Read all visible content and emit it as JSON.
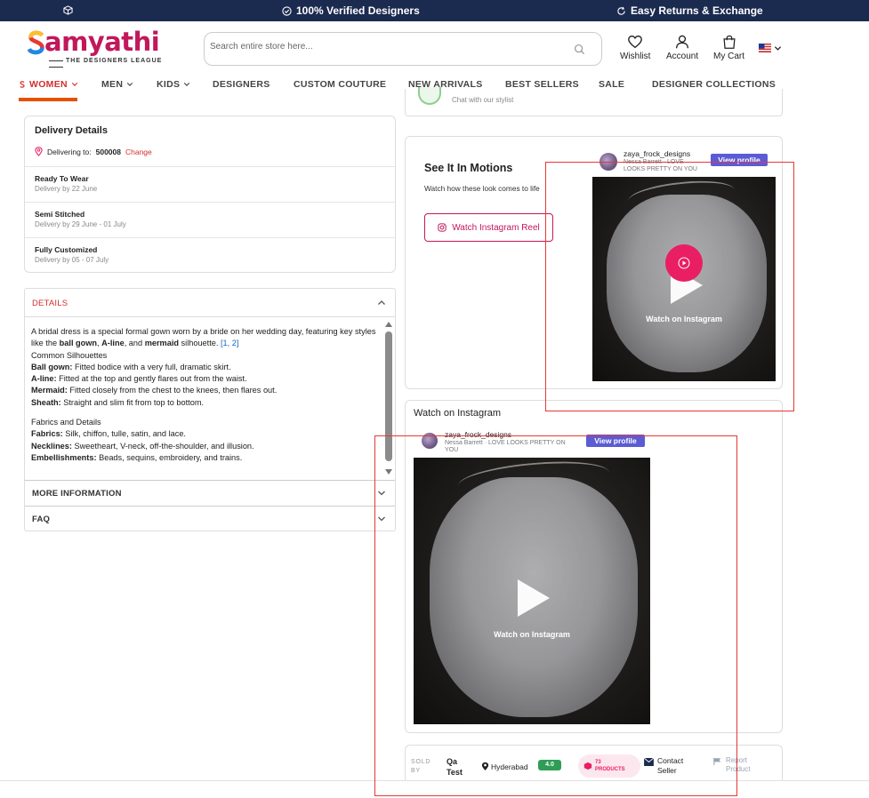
{
  "announcement": {
    "verified": "100% Verified Designers",
    "returns": "Easy Returns & Exchange"
  },
  "brand": {
    "name": "Samyathi",
    "tagline": "THE DESIGNERS LEAGUE",
    "accent": "#c2185b"
  },
  "search": {
    "placeholder": "Search entire store here..."
  },
  "header_actions": {
    "wishlist": "Wishlist",
    "account": "Account",
    "cart": "My Cart"
  },
  "nav": {
    "women": "WOMEN",
    "men": "MEN",
    "kids": "KIDS",
    "designers": "DESIGNERS",
    "custom": "CUSTOM COUTURE",
    "new": "NEW ARRIVALS",
    "best": "BEST SELLERS",
    "sale": "SALE",
    "collections": "DESIGNER COLLECTIONS"
  },
  "stylist": {
    "text": "Chat with our stylist"
  },
  "delivery": {
    "title": "Delivery Details",
    "delivering_to_label": "Delivering to:",
    "pincode": "500008",
    "change": "Change",
    "options": [
      {
        "title": "Ready To Wear",
        "sub": "Delivery by 22 June"
      },
      {
        "title": "Semi Stitched",
        "sub": "Delivery by 29 June - 01 July"
      },
      {
        "title": "Fully Customized",
        "sub": "Delivery by 05 - 07 July"
      }
    ]
  },
  "details": {
    "header": "DETAILS",
    "intro_a": "A bridal dress is ",
    "intro_b": "a special formal gown worn by a bride on her wedding day",
    "intro_c": ", featuring key styles like the ",
    "ballgown": "ball gown",
    "comma": ", ",
    "aline": "A-line",
    "and": ", and ",
    "mermaid": "mermaid",
    "silhouette": " silhouette. ",
    "refs": "[1, 2]",
    "common": "Common Silhouettes",
    "rows": [
      {
        "k": "Ball gown:",
        "v": " Fitted bodice with a very full, dramatic skirt."
      },
      {
        "k": "A-line:",
        "v": " Fitted at the top and gently flares out from the waist."
      },
      {
        "k": "Mermaid:",
        "v": " Fitted closely from the chest to the knees, then flares out."
      },
      {
        "k": "Sheath:",
        "v": " Straight and slim fit from top to bottom."
      }
    ],
    "fabrics_title": "Fabrics and Details",
    "rows2": [
      {
        "k": "Fabrics:",
        "v": " Silk, chiffon, tulle, satin, and lace."
      },
      {
        "k": "Necklines:",
        "v": " Sweetheart, V-neck, off-the-shoulder, and illusion."
      },
      {
        "k": "Embellishments:",
        "v": " Beads, sequins, embroidery, and trains."
      }
    ]
  },
  "more_info": "MORE INFORMATION",
  "faq": "FAQ",
  "motion": {
    "title": "See It In Motions",
    "sub": "Watch how these look comes to life",
    "button": "Watch Instagram Reel"
  },
  "instagram_small": {
    "user": "zaya_frock_designs",
    "sub": "Nessa Barrett · LOVE LOOKS PRETTY ON YOU",
    "view": "View profile",
    "watch": "Watch on Instagram"
  },
  "instagram_large": {
    "title": "Watch on Instagram",
    "user": "zaya_frock_designs",
    "sub": "Nessa Barrett · LOVE LOOKS PRETTY ON YOU",
    "view": "View profile",
    "watch": "Watch on Instagram"
  },
  "seller": {
    "sold_by": "SOLD BY",
    "name": "Qa Test",
    "location": "Hyderabad",
    "rating": "4.0",
    "products": "73 PRODUCTS",
    "contact": "Contact Seller",
    "report": "Report Product"
  }
}
